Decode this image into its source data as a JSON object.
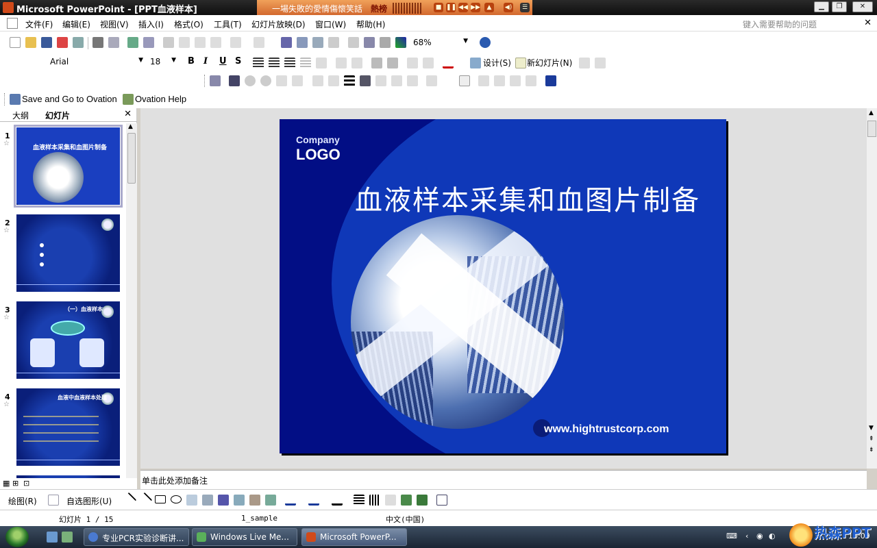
{
  "window": {
    "title": "Microsoft PowerPoint - [PPT血液样本]"
  },
  "player": {
    "song": "一場失敗的愛情傷懷笑話",
    "hot": "熱榜"
  },
  "menu": {
    "items": [
      "文件(F)",
      "编辑(E)",
      "视图(V)",
      "插入(I)",
      "格式(O)",
      "工具(T)",
      "幻灯片放映(D)",
      "窗口(W)",
      "帮助(H)"
    ],
    "help_placeholder": "键入需要帮助的问题"
  },
  "toolbar": {
    "zoom": "68%",
    "font": "Arial",
    "font_size": "18",
    "bold": "B",
    "italic": "I",
    "underline": "U",
    "shadow": "S",
    "design_label": "设计(S)",
    "new_slide_label": "新幻灯片(N)",
    "ovation_save": "Save and Go to Ovation",
    "ovation_help": "Ovation Help"
  },
  "left_pane": {
    "tabs": [
      "大纲",
      "幻灯片"
    ],
    "thumbnails": [
      {
        "num": "1",
        "title": "血液样本采集和血图片制备"
      },
      {
        "num": "2",
        "title": ""
      },
      {
        "num": "3",
        "title": "（一）血液样本"
      },
      {
        "num": "4",
        "title": "血液中血液样本处理"
      }
    ]
  },
  "slide": {
    "company": "Company",
    "logo": "LOGO",
    "title": "血液样本采集和血图片制备",
    "url": "www.hightrustcorp.com"
  },
  "notes": {
    "placeholder": "单击此处添加备注"
  },
  "drawing": {
    "draw_label": "绘图(R)",
    "autoshapes_label": "自选图形(U)"
  },
  "status": {
    "slide_pos": "幻灯片 1 / 15",
    "template": "1_sample",
    "language": "中文(中国)"
  },
  "taskbar": {
    "tasks": [
      "专业PCR实验诊断讲...",
      "Windows Live Me...",
      "Microsoft PowerP..."
    ],
    "time": "10:09"
  },
  "brand": {
    "text": "热森PPT"
  }
}
